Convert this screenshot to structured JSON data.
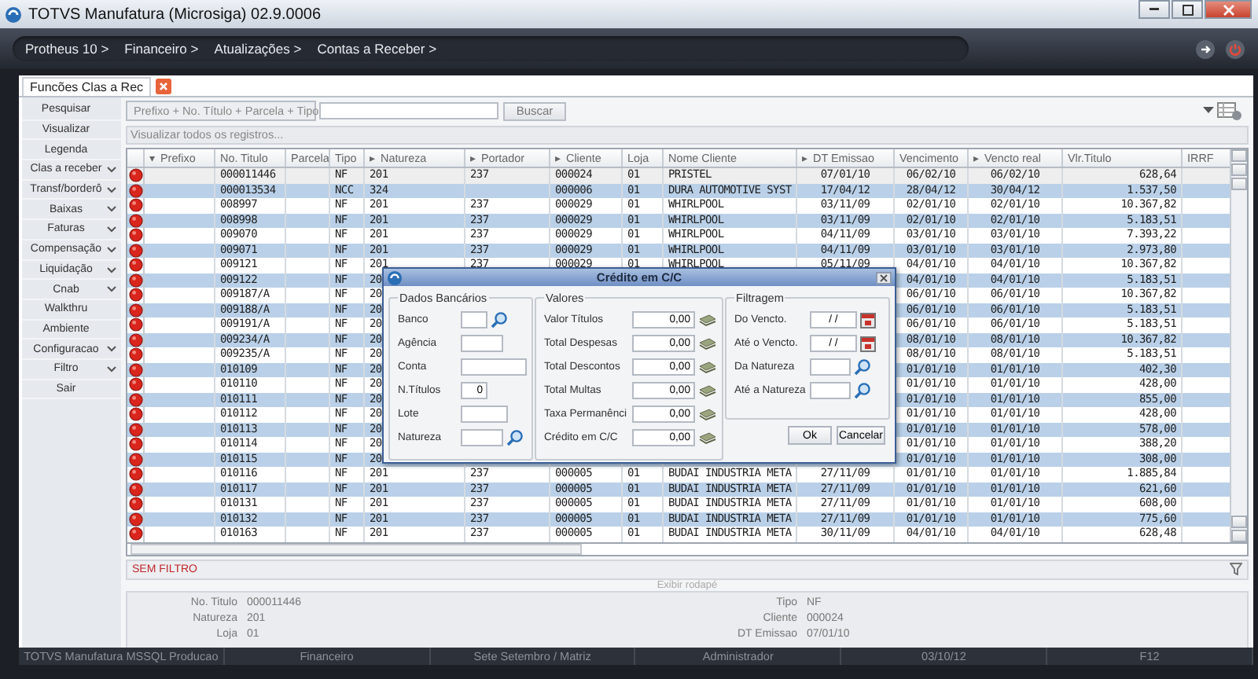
{
  "window": {
    "title": "TOTVS Manufatura (Microsiga) 02.9.0006"
  },
  "breadcrumbs": [
    "Protheus 10 >",
    "Financeiro >",
    "Atualizações >",
    "Contas a Receber >"
  ],
  "tab": {
    "label": "Funcões Clas a Rec"
  },
  "sidebar": {
    "items": [
      {
        "label": "Pesquisar",
        "kind": "action"
      },
      {
        "label": "Visualizar",
        "kind": "action"
      },
      {
        "label": "Legenda",
        "kind": "action"
      },
      {
        "label": "Clas a receber",
        "kind": "menu"
      },
      {
        "label": "Transf/borderô",
        "kind": "menu"
      },
      {
        "label": "Baixas",
        "kind": "menu"
      },
      {
        "label": "Faturas",
        "kind": "menu"
      },
      {
        "label": "Compensação",
        "kind": "menu"
      },
      {
        "label": "Liquidação",
        "kind": "menu"
      },
      {
        "label": "Cnab",
        "kind": "menu"
      },
      {
        "label": "Walkthru",
        "kind": "action"
      },
      {
        "label": "Ambiente",
        "kind": "action"
      },
      {
        "label": "Configuracao",
        "kind": "menu"
      },
      {
        "label": "Filtro",
        "kind": "menu"
      },
      {
        "label": "Sair",
        "kind": "action"
      }
    ]
  },
  "search": {
    "index": "Prefixo + No. Título + Parcela + Tipo",
    "button": "Buscar",
    "view_all": "Visualizar todos os registros..."
  },
  "table": {
    "columns": [
      {
        "label": "Prefixo",
        "indicator": "▾"
      },
      {
        "label": "No. Titulo"
      },
      {
        "label": "Parcela"
      },
      {
        "label": "Tipo"
      },
      {
        "label": "Natureza",
        "indicator": "▸"
      },
      {
        "label": "Portador",
        "indicator": "▸"
      },
      {
        "label": "Cliente",
        "indicator": "▸"
      },
      {
        "label": "Loja"
      },
      {
        "label": "Nome Cliente"
      },
      {
        "label": "DT Emissao",
        "indicator": "▸"
      },
      {
        "label": "Vencimento"
      },
      {
        "label": "Vencto real",
        "indicator": "▸"
      },
      {
        "label": "Vlr.Titulo"
      },
      {
        "label": "IRRF"
      }
    ],
    "rows": [
      [
        null,
        "000011446",
        null,
        "NF",
        "201",
        "237",
        "000024",
        "01",
        "PRISTEL",
        "07/01/10",
        "06/02/10",
        "06/02/10",
        "628,64",
        null
      ],
      [
        null,
        "000013534",
        null,
        "NCC",
        "324",
        null,
        "000006",
        "01",
        "DURA AUTOMOTIVE SYST",
        "17/04/12",
        "28/04/12",
        "30/04/12",
        "1.537,50",
        null
      ],
      [
        null,
        "008997",
        null,
        "NF",
        "201",
        "237",
        "000029",
        "01",
        "WHIRLPOOL",
        "03/11/09",
        "02/01/10",
        "02/01/10",
        "10.367,82",
        null
      ],
      [
        null,
        "008998",
        null,
        "NF",
        "201",
        "237",
        "000029",
        "01",
        "WHIRLPOOL",
        "03/11/09",
        "02/01/10",
        "02/01/10",
        "5.183,51",
        null
      ],
      [
        null,
        "009070",
        null,
        "NF",
        "201",
        "237",
        "000029",
        "01",
        "WHIRLPOOL",
        "04/11/09",
        "03/01/10",
        "03/01/10",
        "7.393,22",
        null
      ],
      [
        null,
        "009071",
        null,
        "NF",
        "201",
        "237",
        "000029",
        "01",
        "WHIRLPOOL",
        "04/11/09",
        "03/01/10",
        "03/01/10",
        "2.973,80",
        null
      ],
      [
        null,
        "009121",
        null,
        "NF",
        "201",
        "237",
        "000029",
        "01",
        "WHIRLPOOL",
        "05/11/09",
        "04/01/10",
        "04/01/10",
        "10.367,82",
        null
      ],
      [
        null,
        "009122",
        null,
        "NF",
        "20",
        null,
        null,
        null,
        null,
        null,
        "04/01/10",
        "04/01/10",
        "5.183,51",
        null
      ],
      [
        null,
        "009187/A",
        null,
        "NF",
        "20",
        null,
        null,
        null,
        null,
        null,
        "06/01/10",
        "06/01/10",
        "10.367,82",
        null
      ],
      [
        null,
        "009188/A",
        null,
        "NF",
        "20",
        null,
        null,
        null,
        null,
        null,
        "06/01/10",
        "06/01/10",
        "5.183,51",
        null
      ],
      [
        null,
        "009191/A",
        null,
        "NF",
        "20",
        null,
        null,
        null,
        null,
        null,
        "06/01/10",
        "06/01/10",
        "5.183,51",
        null
      ],
      [
        null,
        "009234/A",
        null,
        "NF",
        "20",
        null,
        null,
        null,
        null,
        null,
        "08/01/10",
        "08/01/10",
        "10.367,82",
        null
      ],
      [
        null,
        "009235/A",
        null,
        "NF",
        "20",
        null,
        null,
        null,
        null,
        null,
        "08/01/10",
        "08/01/10",
        "5.183,51",
        null
      ],
      [
        null,
        "010109",
        null,
        "NF",
        "20",
        null,
        null,
        null,
        null,
        null,
        "01/01/10",
        "01/01/10",
        "402,30",
        null
      ],
      [
        null,
        "010110",
        null,
        "NF",
        "20",
        null,
        null,
        null,
        null,
        null,
        "01/01/10",
        "01/01/10",
        "428,00",
        null
      ],
      [
        null,
        "010111",
        null,
        "NF",
        "20",
        null,
        null,
        null,
        null,
        null,
        "01/01/10",
        "01/01/10",
        "855,00",
        null
      ],
      [
        null,
        "010112",
        null,
        "NF",
        "20",
        null,
        null,
        null,
        null,
        null,
        "01/01/10",
        "01/01/10",
        "428,00",
        null
      ],
      [
        null,
        "010113",
        null,
        "NF",
        "20",
        null,
        null,
        null,
        null,
        null,
        "01/01/10",
        "01/01/10",
        "578,00",
        null
      ],
      [
        null,
        "010114",
        null,
        "NF",
        "20",
        null,
        null,
        null,
        null,
        null,
        "01/01/10",
        "01/01/10",
        "388,20",
        null
      ],
      [
        null,
        "010115",
        null,
        "NF",
        "20",
        null,
        null,
        null,
        null,
        null,
        "01/01/10",
        "01/01/10",
        "308,00",
        null
      ],
      [
        null,
        "010116",
        null,
        "NF",
        "201",
        "237",
        "000005",
        "01",
        "BUDAI INDUSTRIA META",
        "27/11/09",
        "01/01/10",
        "01/01/10",
        "1.885,84",
        null
      ],
      [
        null,
        "010117",
        null,
        "NF",
        "201",
        "237",
        "000005",
        "01",
        "BUDAI INDUSTRIA META",
        "27/11/09",
        "01/01/10",
        "01/01/10",
        "621,60",
        null
      ],
      [
        null,
        "010131",
        null,
        "NF",
        "201",
        "237",
        "000005",
        "01",
        "BUDAI INDUSTRIA META",
        "27/11/09",
        "01/01/10",
        "01/01/10",
        "608,00",
        null
      ],
      [
        null,
        "010132",
        null,
        "NF",
        "201",
        "237",
        "000005",
        "01",
        "BUDAI INDUSTRIA META",
        "27/11/09",
        "01/01/10",
        "01/01/10",
        "775,60",
        null
      ],
      [
        null,
        "010163",
        null,
        "NF",
        "201",
        "237",
        "000005",
        "01",
        "BUDAI INDUSTRIA META",
        "30/11/09",
        "04/01/10",
        "04/01/10",
        "628,48",
        null
      ]
    ]
  },
  "filter_status": "SEM FILTRO",
  "footer_toggle": "Exibir rodapé",
  "details": {
    "left": [
      {
        "label": "No. Titulo",
        "value": "000011446"
      },
      {
        "label": "Natureza",
        "value": "201"
      },
      {
        "label": "Loja",
        "value": "01"
      }
    ],
    "right": [
      {
        "label": "Tipo",
        "value": "NF"
      },
      {
        "label": "Cliente",
        "value": "000024"
      },
      {
        "label": "DT Emissao",
        "value": "07/01/10"
      }
    ]
  },
  "status_bar": [
    "TOTVS Manufatura MSSQL Producao",
    "Financeiro",
    "Sete Setembro / Matriz",
    "Administrador",
    "03/10/12",
    "F12"
  ],
  "dialog": {
    "title": "Crédito em C/C",
    "groups": [
      {
        "title": "Dados Bancários",
        "fields": [
          {
            "label": "Banco",
            "kind": "search"
          },
          {
            "label": "Agência",
            "kind": "plain"
          },
          {
            "label": "Conta",
            "kind": "plain"
          },
          {
            "label": "N.Títulos",
            "value": "0",
            "kind": "plain"
          },
          {
            "label": "Lote",
            "kind": "plain"
          },
          {
            "label": "Natureza",
            "kind": "search"
          }
        ]
      },
      {
        "title": "Valores",
        "fields": [
          {
            "label": "Valor Títulos",
            "value": "0,00",
            "kind": "money"
          },
          {
            "label": "Total Despesas",
            "value": "0,00",
            "kind": "money"
          },
          {
            "label": "Total Descontos",
            "value": "0,00",
            "kind": "money"
          },
          {
            "label": "Total Multas",
            "value": "0,00",
            "kind": "money"
          },
          {
            "label": "Taxa Permanênci",
            "value": "0,00",
            "kind": "money"
          },
          {
            "label": "Crédito em C/C",
            "value": "0,00",
            "kind": "money"
          }
        ]
      },
      {
        "title": "Filtragem",
        "fields": [
          {
            "label": "Do Vencto.",
            "value": "/ /",
            "kind": "calendar"
          },
          {
            "label": "Até o Vencto.",
            "value": "/ /",
            "kind": "calendar"
          },
          {
            "label": "Da Natureza",
            "kind": "search"
          },
          {
            "label": "Até a Natureza",
            "kind": "search"
          }
        ]
      }
    ],
    "buttons": [
      "Ok",
      "Cancelar"
    ]
  }
}
